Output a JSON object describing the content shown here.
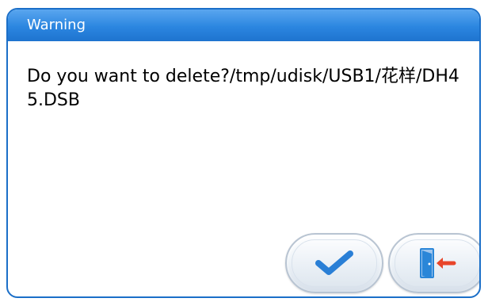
{
  "dialog": {
    "title": "Warning",
    "message": "Do you want to delete?/tmp/udisk/USB1/花样/DH45.DSB",
    "buttons": [
      {
        "name": "confirm",
        "icon": "checkmark-icon"
      },
      {
        "name": "exit",
        "icon": "exit-door-icon"
      }
    ]
  },
  "colors": {
    "title_bar": "#2b86e0",
    "border": "#1b6fc8",
    "check": "#2a7fd6",
    "door": "#2a86d8",
    "arrow": "#e8452a"
  }
}
